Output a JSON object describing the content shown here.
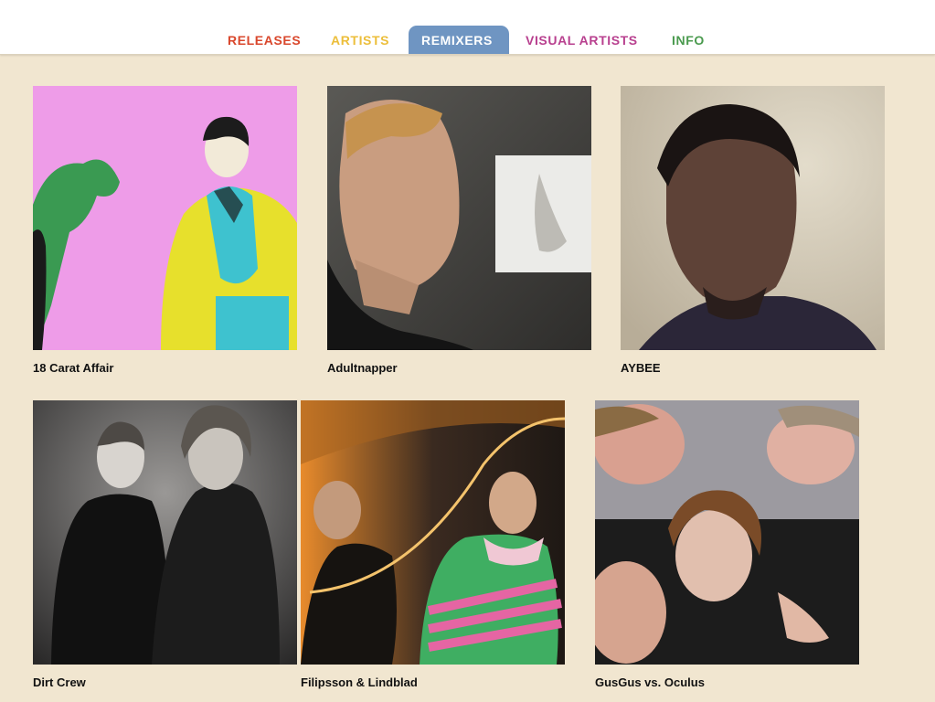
{
  "nav": {
    "tabs": [
      {
        "label": "RELEASES",
        "color": "#d9472c",
        "active": false
      },
      {
        "label": "ARTISTS",
        "color": "#ecbe3a",
        "active": false
      },
      {
        "label": "REMIXERS",
        "color": "#ffffff",
        "active": true
      },
      {
        "label": "VISUAL ARTISTS",
        "color": "#b8408f",
        "active": false
      },
      {
        "label": "INFO",
        "color": "#4a9a4e",
        "active": false
      }
    ],
    "active_tab_color": "#6f95c2"
  },
  "remixers": [
    {
      "name": "18 Carat Affair"
    },
    {
      "name": "Adultnapper"
    },
    {
      "name": "AYBEE"
    },
    {
      "name": "Dirt Crew"
    },
    {
      "name": "Filipsson & Lindblad"
    },
    {
      "name": "GusGus vs. Oculus"
    }
  ],
  "colors": {
    "page_background": "#f1e6d0",
    "header_background": "#ffffff"
  }
}
